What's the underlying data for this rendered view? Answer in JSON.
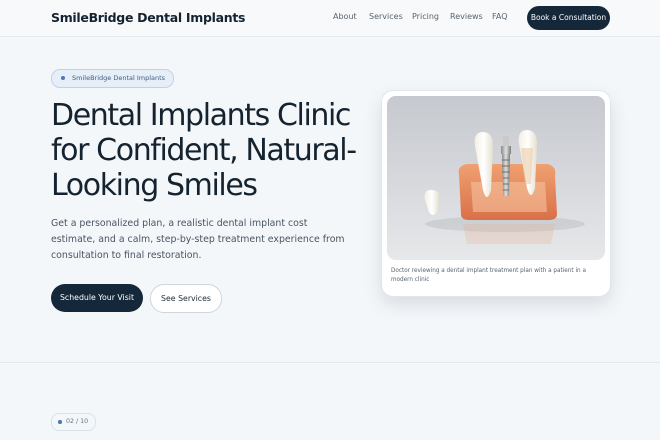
{
  "brand": "SmileBridge Dental Implants",
  "nav": {
    "links": [
      "About",
      "Services",
      "Pricing",
      "Reviews",
      "FAQ"
    ],
    "cta": "Book a Consultation"
  },
  "hero": {
    "badge": "SmileBridge Dental Implants",
    "title": "Dental Implants Clinic for Confident, Natural-Looking Smiles",
    "description": "Get a personalized plan, a realistic dental implant cost estimate, and a calm, step-by-step treatment experience from consultation to final restoration.",
    "primary_button": "Schedule Your Visit",
    "secondary_button": "See Services"
  },
  "card": {
    "image_alt": "Dental implant model",
    "caption": "Doctor reviewing a dental implant treatment plan with a patient in a modern clinic"
  },
  "section_counter": "02 / 10",
  "colors": {
    "primary": "#14283a",
    "background": "#f4f7fa",
    "accent": "#4d78b5"
  }
}
